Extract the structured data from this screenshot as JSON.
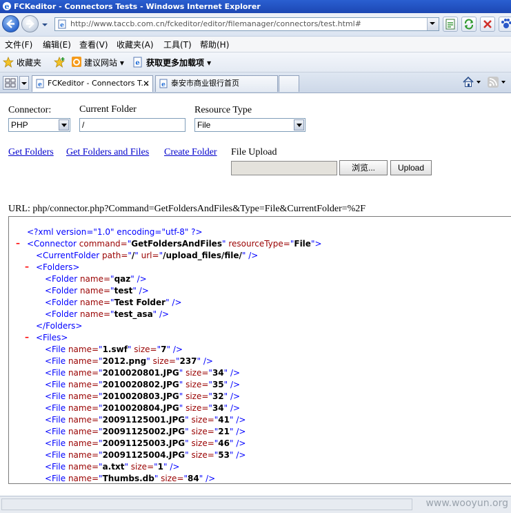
{
  "window": {
    "title": "FCKeditor - Connectors Tests - Windows Internet Explorer"
  },
  "address_bar": {
    "url": "http://www.taccb.com.cn/fckeditor/editor/filemanager/connectors/test.html#"
  },
  "menu": [
    "文件(F)",
    "编辑(E)",
    "查看(V)",
    "收藏夹(A)",
    "工具(T)",
    "帮助(H)"
  ],
  "favorites_bar": {
    "favorites_label": "收藏夹",
    "suggested_sites": "建议网站 ▾",
    "get_addons": "获取更多加载项 ▾"
  },
  "tabs": [
    {
      "label": "FCKeditor - Connectors T..."
    },
    {
      "label": "泰安市商业银行首页"
    }
  ],
  "form": {
    "connector_label": "Connector:",
    "connector_value": "PHP",
    "current_folder_label": "Current Folder",
    "current_folder_value": "/",
    "resource_type_label": "Resource Type",
    "resource_type_value": "File",
    "links": [
      "Get Folders",
      "Get Folders and Files",
      "Create Folder"
    ],
    "file_upload_label": "File Upload",
    "browse_button": "浏览...",
    "upload_button": "Upload"
  },
  "url_line": "URL: php/connector.php?Command=GetFoldersAndFiles&Type=File&CurrentFolder=%2F",
  "xml": {
    "declaration": "<?xml version=\"1.0\" encoding=\"utf-8\" ?>",
    "connector": {
      "command": "GetFoldersAndFiles",
      "resourceType": "File"
    },
    "current_folder": {
      "path": "/",
      "url": "/upload_files/file/"
    },
    "folders": [
      "qaz",
      "test",
      "Test Folder",
      "test_asa"
    ],
    "files": [
      {
        "name": "1.swf",
        "size": "7"
      },
      {
        "name": "2012.png",
        "size": "237"
      },
      {
        "name": "2010020801.JPG",
        "size": "34"
      },
      {
        "name": "2010020802.JPG",
        "size": "35"
      },
      {
        "name": "2010020803.JPG",
        "size": "32"
      },
      {
        "name": "2010020804.JPG",
        "size": "34"
      },
      {
        "name": "20091125001.JPG",
        "size": "41"
      },
      {
        "name": "20091125002.JPG",
        "size": "21"
      },
      {
        "name": "20091125003.JPG",
        "size": "46"
      },
      {
        "name": "20091125004.JPG",
        "size": "53"
      },
      {
        "name": "a.txt",
        "size": "1"
      },
      {
        "name": "Thumbs.db",
        "size": "84"
      }
    ]
  },
  "watermark": "www.wooyun.org"
}
